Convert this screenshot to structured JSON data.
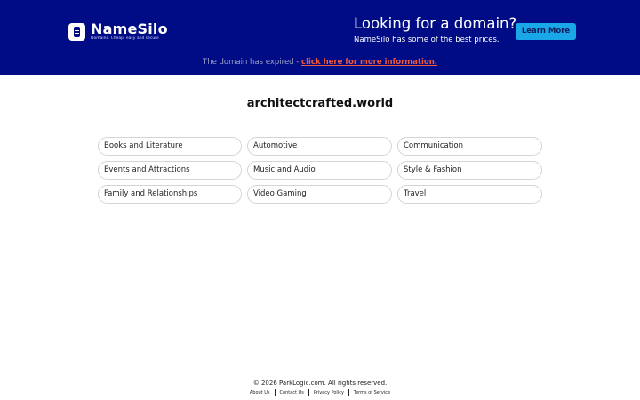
{
  "header": {
    "logo_name": "NameSilo",
    "logo_tagline": "Domains. Cheap, easy and secure",
    "promo_title": "Looking for a domain?",
    "promo_subtitle": "NameSilo has some of the best prices.",
    "learn_more_label": "Learn More"
  },
  "notice": {
    "text": "The domain has expired - ",
    "link_label": "click here for more information."
  },
  "domain": "architectcrafted.world",
  "categories": [
    "Books and Literature",
    "Automotive",
    "Communication",
    "Events and Attractions",
    "Music and Audio",
    "Style & Fashion",
    "Family and Relationships",
    "Video Gaming",
    "Travel"
  ],
  "footer": {
    "copyright": "© 2026 ParkLogic.com. All rights reserved.",
    "links": [
      "About Us",
      "Contact Us",
      "Privacy Policy",
      "Terms of Service"
    ]
  },
  "colors": {
    "header_bg": "#000c85",
    "button_bg": "#1aa7e8",
    "link": "#f15a3a"
  }
}
